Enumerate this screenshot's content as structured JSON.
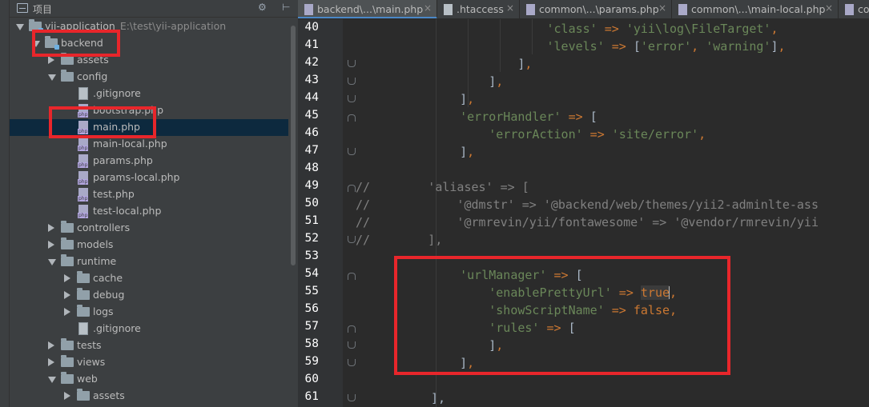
{
  "project_panel": {
    "title": "项目",
    "header_buttons": [
      "⚙",
      "⊢"
    ],
    "tree": [
      {
        "label": "yii-application",
        "extra": "E:\\test\\yii-application",
        "kind": "root",
        "expanded": true
      },
      {
        "label": "backend",
        "kind": "module",
        "expanded": true,
        "highlighted": true
      },
      {
        "label": "assets",
        "kind": "folder",
        "expanded": false
      },
      {
        "label": "config",
        "kind": "folder",
        "expanded": true
      },
      {
        "label": ".gitignore",
        "kind": "text"
      },
      {
        "label": "bootstrap.php",
        "kind": "php"
      },
      {
        "label": "main.php",
        "kind": "php",
        "selected": true,
        "highlighted": true
      },
      {
        "label": "main-local.php",
        "kind": "php"
      },
      {
        "label": "params.php",
        "kind": "php"
      },
      {
        "label": "params-local.php",
        "kind": "php"
      },
      {
        "label": "test.php",
        "kind": "php"
      },
      {
        "label": "test-local.php",
        "kind": "php"
      },
      {
        "label": "controllers",
        "kind": "folder",
        "expanded": false
      },
      {
        "label": "models",
        "kind": "folder",
        "expanded": false
      },
      {
        "label": "runtime",
        "kind": "folder",
        "expanded": true
      },
      {
        "label": "cache",
        "kind": "folder",
        "expanded": false
      },
      {
        "label": "debug",
        "kind": "folder",
        "expanded": false
      },
      {
        "label": "logs",
        "kind": "folder",
        "expanded": false
      },
      {
        "label": ".gitignore",
        "kind": "text"
      },
      {
        "label": "tests",
        "kind": "folder",
        "expanded": false
      },
      {
        "label": "views",
        "kind": "folder",
        "expanded": false
      },
      {
        "label": "web",
        "kind": "folder",
        "expanded": true
      },
      {
        "label": "assets",
        "kind": "folder",
        "expanded": false
      }
    ]
  },
  "tabs": [
    {
      "label": "backend\\...\\main.php",
      "kind": "php",
      "active": true
    },
    {
      "label": ".htaccess",
      "kind": "text",
      "active": false
    },
    {
      "label": "common\\...\\params.php",
      "kind": "php",
      "active": false
    },
    {
      "label": "common\\...\\main-local.php",
      "kind": "php",
      "active": false
    },
    {
      "label": "co",
      "kind": "php",
      "active": false
    }
  ],
  "tab_close_glyph": "×",
  "editor": {
    "lines": [
      {
        "n": "40",
        "tokens": [
          [
            "p",
            "                "
          ],
          [
            "s",
            "'class'"
          ],
          [
            "o",
            " => "
          ],
          [
            "s",
            "'yii\\log\\FileTarget'"
          ],
          [
            "o",
            ","
          ]
        ]
      },
      {
        "n": "41",
        "tokens": [
          [
            "p",
            "                "
          ],
          [
            "s",
            "'levels'"
          ],
          [
            "o",
            " => "
          ],
          [
            "p",
            "["
          ],
          [
            "s",
            "'error'"
          ],
          [
            "o",
            ", "
          ],
          [
            "s",
            "'warning'"
          ],
          [
            "p",
            "]"
          ],
          [
            "o",
            ","
          ]
        ]
      },
      {
        "n": "42",
        "tokens": [
          [
            "p",
            "            ]"
          ],
          [
            "o",
            ","
          ]
        ]
      },
      {
        "n": "43",
        "tokens": [
          [
            "p",
            "        ]"
          ],
          [
            "o",
            ","
          ]
        ]
      },
      {
        "n": "44",
        "tokens": [
          [
            "p",
            "    ]"
          ],
          [
            "o",
            ","
          ]
        ]
      },
      {
        "n": "45",
        "tokens": [
          [
            "p",
            "    "
          ],
          [
            "s",
            "'errorHandler'"
          ],
          [
            "o",
            " => "
          ],
          [
            "p",
            "["
          ]
        ]
      },
      {
        "n": "46",
        "tokens": [
          [
            "p",
            "        "
          ],
          [
            "s",
            "'errorAction'"
          ],
          [
            "o",
            " => "
          ],
          [
            "s",
            "'site/error'"
          ],
          [
            "o",
            ","
          ]
        ]
      },
      {
        "n": "47",
        "tokens": [
          [
            "p",
            "    ]"
          ],
          [
            "o",
            ","
          ]
        ]
      },
      {
        "n": "48",
        "tokens": []
      },
      {
        "n": "49",
        "tokens": [
          [
            "c",
            "//        'aliases' => ["
          ]
        ]
      },
      {
        "n": "50",
        "tokens": [
          [
            "c",
            "//            '@dmstr' => '@backend/web/themes/yii2-adminlte-ass"
          ]
        ]
      },
      {
        "n": "51",
        "tokens": [
          [
            "c",
            "//            '@rmrevin/yii/fontawesome' => '@vendor/rmrevin/yii"
          ]
        ]
      },
      {
        "n": "52",
        "tokens": [
          [
            "c",
            "//        ],"
          ]
        ]
      },
      {
        "n": "53",
        "tokens": []
      },
      {
        "n": "54",
        "tokens": [
          [
            "p",
            "    "
          ],
          [
            "s",
            "'urlManager'"
          ],
          [
            "o",
            " => "
          ],
          [
            "p",
            "["
          ]
        ]
      },
      {
        "n": "55",
        "tokens": [
          [
            "p",
            "        "
          ],
          [
            "s",
            "'enablePrettyUrl'"
          ],
          [
            "o",
            " => "
          ],
          [
            "t",
            "true"
          ],
          [
            "o",
            ","
          ]
        ]
      },
      {
        "n": "56",
        "tokens": [
          [
            "p",
            "        "
          ],
          [
            "s",
            "'showScriptName'"
          ],
          [
            "o",
            " => "
          ],
          [
            "k",
            "false"
          ],
          [
            "o",
            ","
          ]
        ]
      },
      {
        "n": "57",
        "tokens": [
          [
            "p",
            "        "
          ],
          [
            "s",
            "'rules'"
          ],
          [
            "o",
            " => "
          ],
          [
            "p",
            "["
          ]
        ]
      },
      {
        "n": "58",
        "tokens": [
          [
            "p",
            "        ]"
          ],
          [
            "o",
            ","
          ]
        ]
      },
      {
        "n": "59",
        "tokens": [
          [
            "p",
            "    ]"
          ],
          [
            "o",
            ","
          ]
        ]
      },
      {
        "n": "60",
        "tokens": []
      },
      {
        "n": "61",
        "tokens": [
          [
            "p",
            "],"
          ]
        ]
      }
    ]
  },
  "colors": {
    "string": "#6a8759",
    "keyword": "#cc7832",
    "comment": "#808080",
    "highlight_box": "#e8262b",
    "active_tab_underline": "#4a88c7"
  }
}
